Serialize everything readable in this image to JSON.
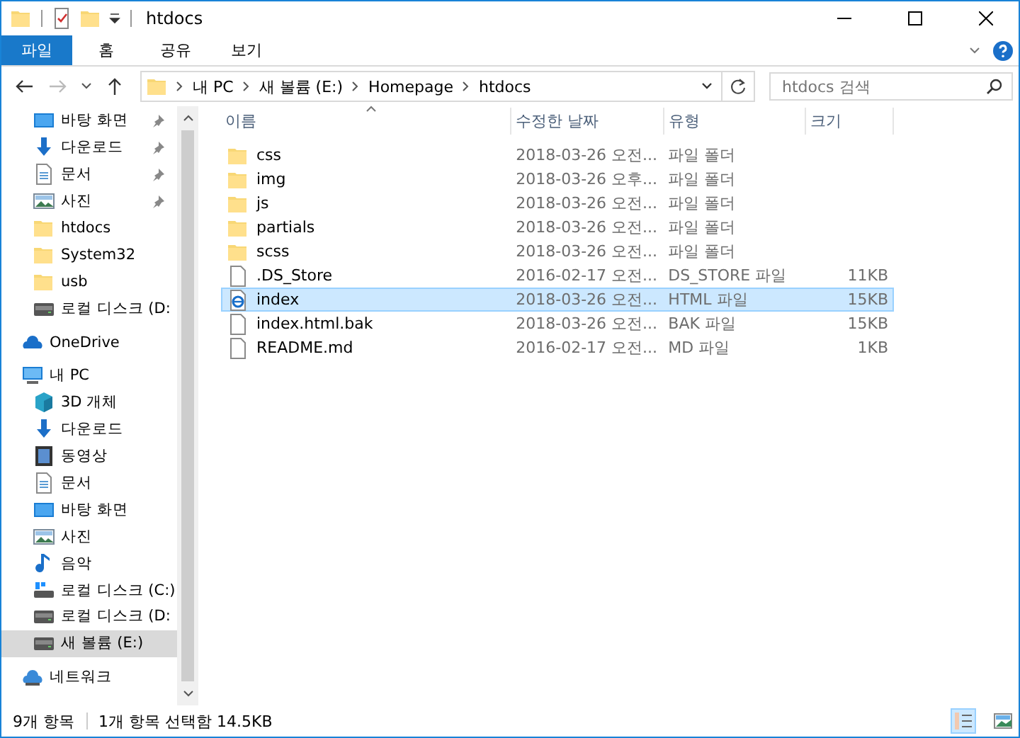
{
  "window": {
    "title": "htdocs"
  },
  "ribbon_tabs": [
    {
      "label": "파일",
      "kind": "menu"
    },
    {
      "label": "홈",
      "kind": "tab"
    },
    {
      "label": "공유",
      "kind": "tab"
    },
    {
      "label": "보기",
      "kind": "tab"
    }
  ],
  "address": {
    "crumbs": [
      "내 PC",
      "새 볼륨 (E:)",
      "Homepage",
      "htdocs"
    ]
  },
  "search": {
    "placeholder": "htdocs 검색"
  },
  "nav": {
    "pinned": [
      {
        "label": "바탕 화면",
        "kind": "desktop",
        "pinned": true,
        "selected": false
      },
      {
        "label": "다운로드",
        "kind": "download",
        "pinned": true,
        "selected": false
      },
      {
        "label": "문서",
        "kind": "document",
        "pinned": true,
        "selected": false
      },
      {
        "label": "사진",
        "kind": "picture",
        "pinned": true,
        "selected": false
      },
      {
        "label": "htdocs",
        "kind": "folder",
        "pinned": false,
        "selected": false
      },
      {
        "label": "System32",
        "kind": "folder",
        "pinned": false,
        "selected": false
      },
      {
        "label": "usb",
        "kind": "folder",
        "pinned": false,
        "selected": false
      },
      {
        "label": "로컬 디스크 (D:",
        "kind": "drive",
        "pinned": false,
        "selected": false
      }
    ],
    "tree": [
      {
        "label": "OneDrive",
        "kind": "cloud",
        "selected": false
      },
      {
        "label": "내 PC",
        "kind": "pc",
        "selected": false,
        "children": [
          {
            "label": "3D 개체",
            "kind": "cube",
            "selected": false
          },
          {
            "label": "다운로드",
            "kind": "download",
            "selected": false
          },
          {
            "label": "동영상",
            "kind": "video",
            "selected": false
          },
          {
            "label": "문서",
            "kind": "document",
            "selected": false
          },
          {
            "label": "바탕 화면",
            "kind": "desktop",
            "selected": false
          },
          {
            "label": "사진",
            "kind": "picture",
            "selected": false
          },
          {
            "label": "음악",
            "kind": "music",
            "selected": false
          },
          {
            "label": "로컬 디스크 (C:)",
            "kind": "sysdrive",
            "selected": false
          },
          {
            "label": "로컬 디스크 (D:",
            "kind": "drive",
            "selected": false
          },
          {
            "label": "새 볼륨 (E:)",
            "kind": "drive",
            "selected": true
          }
        ]
      },
      {
        "label": "네트워크",
        "kind": "network",
        "selected": false
      }
    ]
  },
  "table": {
    "columns": [
      {
        "label": "이름",
        "sorted": true
      },
      {
        "label": "수정한 날짜",
        "sorted": false
      },
      {
        "label": "유형",
        "sorted": false
      },
      {
        "label": "크기",
        "sorted": false
      }
    ],
    "rows": [
      {
        "name": "css",
        "date": "2018-03-26 오전...",
        "type": "파일 폴더",
        "kind": "folder",
        "selected": false
      },
      {
        "name": "img",
        "date": "2018-03-26 오후...",
        "type": "파일 폴더",
        "kind": "folder",
        "selected": false
      },
      {
        "name": "js",
        "date": "2018-03-26 오전...",
        "type": "파일 폴더",
        "kind": "folder",
        "selected": false
      },
      {
        "name": "partials",
        "date": "2018-03-26 오전...",
        "type": "파일 폴더",
        "kind": "folder",
        "selected": false
      },
      {
        "name": "scss",
        "date": "2018-03-26 오전...",
        "type": "파일 폴더",
        "kind": "folder",
        "selected": false
      },
      {
        "name": ".DS_Store",
        "date": "2016-02-17 오전...",
        "type": "DS_STORE 파일",
        "size": "11KB",
        "kind": "file",
        "selected": false
      },
      {
        "name": "index",
        "date": "2018-03-26 오전...",
        "type": "HTML 파일",
        "size": "15KB",
        "kind": "html",
        "selected": true
      },
      {
        "name": "index.html.bak",
        "date": "2018-03-26 오전...",
        "type": "BAK 파일",
        "size": "15KB",
        "kind": "file",
        "selected": false
      },
      {
        "name": "README.md",
        "date": "2016-02-17 오전...",
        "type": "MD 파일",
        "size": "1KB",
        "kind": "file",
        "selected": false
      }
    ]
  },
  "status_bar": {
    "count": "9개 항목",
    "selection": "1개 항목 선택함 14.5KB"
  },
  "views": [
    {
      "kind": "details",
      "selected": true
    },
    {
      "kind": "large",
      "selected": false
    }
  ]
}
